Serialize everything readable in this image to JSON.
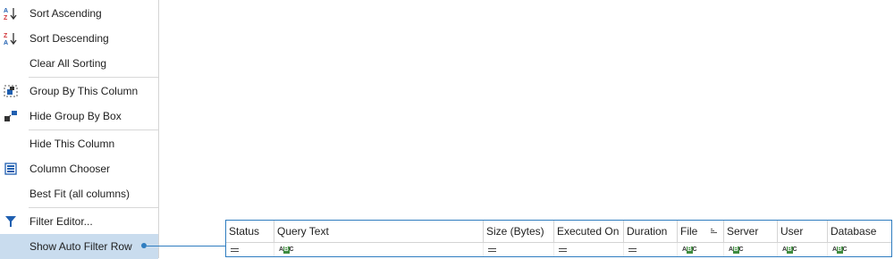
{
  "menu": {
    "items": [
      {
        "label": "Sort Ascending",
        "icon": "sort-ascending-icon"
      },
      {
        "label": "Sort Descending",
        "icon": "sort-descending-icon"
      },
      {
        "label": "Clear All Sorting",
        "icon": ""
      },
      {
        "label": "Group By This Column",
        "icon": "group-by-icon"
      },
      {
        "label": "Hide Group By Box",
        "icon": "hide-group-box-icon"
      },
      {
        "label": "Hide This Column",
        "icon": ""
      },
      {
        "label": "Column Chooser",
        "icon": "column-chooser-icon"
      },
      {
        "label": "Best Fit (all columns)",
        "icon": ""
      },
      {
        "label": "Filter Editor...",
        "icon": "filter-icon"
      },
      {
        "label": "Show Auto Filter Row",
        "icon": ""
      }
    ],
    "highlighted_index": 9
  },
  "grid": {
    "columns": [
      "Status",
      "Query Text",
      "Size (Bytes)",
      "Executed On",
      "Duration",
      "File",
      "Server",
      "User",
      "Database"
    ],
    "filter_row": [
      "equals",
      "contains",
      "equals",
      "equals",
      "equals",
      "contains",
      "contains",
      "contains",
      "contains"
    ]
  },
  "colors": {
    "accent": "#2f7dc0",
    "highlight": "#c9dcee",
    "abc_badge": "#3f8c3f",
    "az_red": "#d13438",
    "az_blue": "#1f5fb0"
  }
}
